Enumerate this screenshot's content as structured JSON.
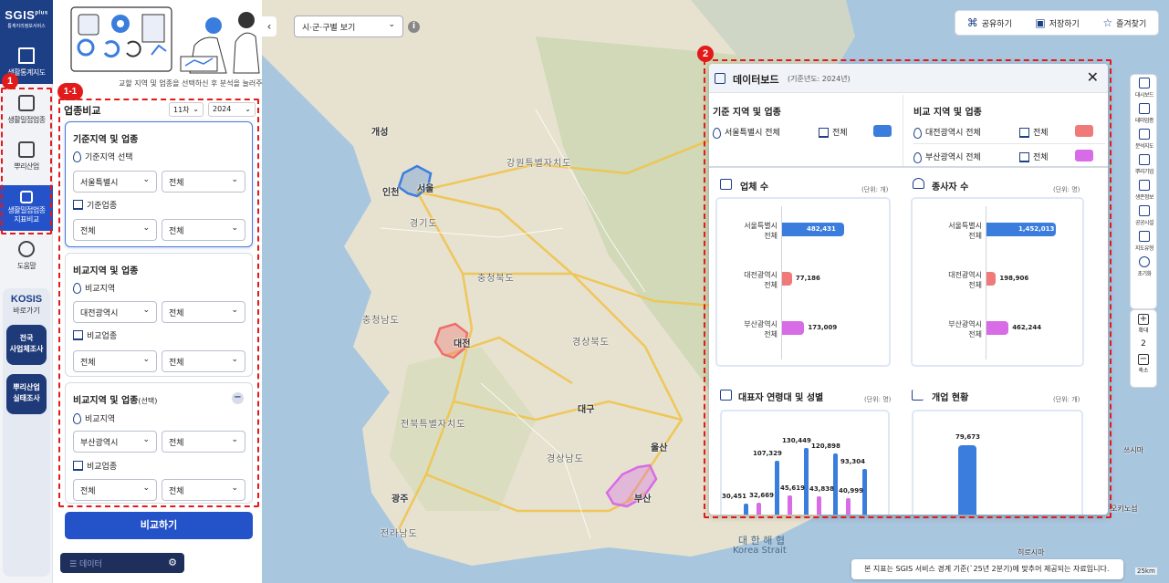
{
  "app": {
    "logo_main": "SGIS",
    "logo_sub": "통계지리정보서비스",
    "logo_plus": "plus"
  },
  "leftnav": {
    "items": [
      {
        "label": "생활통계지도"
      },
      {
        "label": "생활밀접업종"
      },
      {
        "label": "뿌리산업"
      },
      {
        "label": "생활밀접업종\n지표비교"
      },
      {
        "label": "도움말"
      }
    ],
    "kosis_title": "KOSIS",
    "kosis_sub": "바로가기",
    "kosis_btn1": "전국\n사업체조사",
    "kosis_btn2": "뿌리산업\n실태조사"
  },
  "annotations": {
    "badge1": "1",
    "badge1_1": "1-1",
    "badge2": "2",
    "color": "#e21a1a"
  },
  "panel": {
    "guide": "교할 지역 및 업종을 선택하신 후 분석을 눌러주세요.",
    "section_title": "업종비교",
    "period_select": "11차",
    "year_select": "2024",
    "base_card": {
      "title": "기준지역 및 업종",
      "region_label": "기준지역 선택",
      "region_sido": "서울특별시",
      "region_sgg": "전체",
      "industry_label": "기준업종",
      "industry_1": "전체",
      "industry_2": "전체"
    },
    "cmp_card": {
      "title": "비교지역 및 업종",
      "region_label": "비교지역",
      "region_sido": "대전광역시",
      "region_sgg": "전체",
      "industry_label": "비교업종",
      "industry_1": "전체",
      "industry_2": "전체"
    },
    "cmp_card2": {
      "title": "비교지역 및 업종",
      "title_sub": "(선택)",
      "region_label": "비교지역",
      "region_sido": "부산광역시",
      "region_sgg": "전체",
      "industry_label": "비교업종",
      "industry_1": "전체",
      "industry_2": "전체"
    },
    "compare_button": "비교하기",
    "datasource_toggle": "데이터"
  },
  "map": {
    "view_select": "시·군·구별 보기",
    "top_actions": [
      "공유하기",
      "저장하기",
      "즐겨찾기"
    ],
    "right_tools": [
      "대시보드",
      "테마업종",
      "분석지도",
      "뿌리기업",
      "생존정보",
      "공공시설",
      "지도유형",
      "초기화"
    ],
    "zoom_in": "확대",
    "zoom_level": "2",
    "zoom_out": "축소",
    "labels": {
      "gaesong": "개성",
      "incheon": "인천",
      "seoul": "서울",
      "gyeonggi": "경기도",
      "gangwon": "강원특별자치도",
      "chungbuk": "충청북도",
      "chungnam": "충청남도",
      "daejeon": "대전",
      "gyeongbuk": "경상북도",
      "jeonbuk": "전북특별자치도",
      "daegu": "대구",
      "gyeongnam": "경상남도",
      "jeonnam": "전라남도",
      "gwangju": "광주",
      "ulsan": "울산",
      "busan": "부산",
      "strait_kr": "대 한 해 협",
      "strait_en": "Korea Strait",
      "tsushima": "쓰시마",
      "hirado": "히로시마",
      "okinoshima": "오키노섬"
    },
    "footnote": "본 지표는 SGIS 서비스 경계 기준(`25년 2분기)에 맞추어 제공되는 자료입니다.",
    "scale": "25km",
    "colors": {
      "seoul": "#3b7ddd",
      "daejeon": "#f06d6d",
      "busan": "#d86be6"
    }
  },
  "dashboard": {
    "title": "데이터보드",
    "subtitle": "(기준년도: 2024년)",
    "base_header": "기준 지역 및 업종",
    "base_region": "서울특별시 전체",
    "base_industry": "전체",
    "cmp_header": "비교 지역 및 업종",
    "cmp_region_1": "대전광역시 전체",
    "cmp_industry_1": "전체",
    "cmp_region_2": "부산광역시 전체",
    "cmp_industry_2": "전체",
    "colors": {
      "seoul": "#3b7ddd",
      "daejeon": "#f07a7a",
      "busan": "#d86be6"
    },
    "unit_count": "(단위: 개)",
    "unit_people": "(단위: 명)"
  },
  "chart_data": [
    {
      "type": "bar",
      "title": "업체 수",
      "unit": "(단위: 개)",
      "orientation": "horizontal",
      "categories": [
        "서울특별시\n전체",
        "대전광역시\n전체",
        "부산광역시\n전체"
      ],
      "values": [
        482431,
        77186,
        173009
      ],
      "value_labels": [
        "482,431",
        "77,186",
        "173,009"
      ]
    },
    {
      "type": "bar",
      "title": "종사자 수",
      "unit": "(단위: 명)",
      "orientation": "horizontal",
      "categories": [
        "서울특별시\n전체",
        "대전광역시\n전체",
        "부산광역시\n전체"
      ],
      "values": [
        1452013,
        198906,
        462244
      ],
      "value_labels": [
        "1,452,013",
        "198,906",
        "462,244"
      ]
    },
    {
      "type": "bar",
      "title": "대표자 연령대 및 성별",
      "unit": "(단위: 명)",
      "series": [
        {
          "name": "",
          "values": [
            30451,
            107329,
            130449,
            120898,
            93304
          ]
        },
        {
          "name": "",
          "values": [
            32669,
            45619,
            43838,
            40999
          ]
        }
      ],
      "value_labels_a": [
        "30,451",
        "107,329",
        "130,449",
        "120,898",
        "93,304"
      ],
      "value_labels_b": [
        "32,669",
        "45,619",
        "43,838",
        "40,999"
      ]
    },
    {
      "type": "bar",
      "title": "개업 현황",
      "unit": "(단위: 개)",
      "values": [
        79673
      ],
      "value_labels": [
        "79,673"
      ]
    }
  ]
}
